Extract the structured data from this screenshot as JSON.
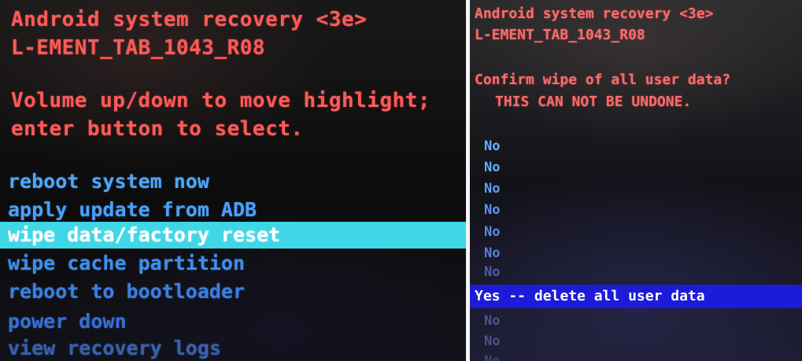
{
  "left_screen": {
    "title": "Android system recovery <3e>",
    "build": "L-EMENT_TAB_1043_R08",
    "instructions": [
      "Volume up/down to move highlight;",
      "enter button to select."
    ],
    "menu": [
      {
        "label": "reboot system now",
        "color": "#4fa6ff"
      },
      {
        "label": "apply update from ADB",
        "color": "#4aa0ff"
      },
      {
        "label": "wipe data/factory reset",
        "color": "#ffffff",
        "selected": true
      },
      {
        "label": "wipe cache partition",
        "color": "#3f8fee"
      },
      {
        "label": "reboot to bootloader",
        "color": "#3a7fe4"
      },
      {
        "label": "power down",
        "color": "#366fd8"
      },
      {
        "label": "view recovery logs",
        "color": "#3a5fb0"
      }
    ],
    "colors": {
      "header_text": "#ff5a58",
      "highlight": "#3fd6e6"
    }
  },
  "right_screen": {
    "title": "Android system recovery <3e>",
    "build": "L-EMENT_TAB_1043_R08",
    "confirm_text": "Confirm wipe of all user data?",
    "warning_text": "THIS CAN NOT BE UNDONE.",
    "options": [
      {
        "label": "No",
        "color": "#6ab0ff"
      },
      {
        "label": "No",
        "color": "#65a8ff"
      },
      {
        "label": "No",
        "color": "#5f9ff8"
      },
      {
        "label": "No",
        "color": "#5a95f0"
      },
      {
        "label": "No",
        "color": "#5a8ae0"
      },
      {
        "label": "No",
        "color": "#5a7ed0"
      },
      {
        "label": "No",
        "color": "#4a5fa8"
      },
      {
        "label": "Yes -- delete all user data",
        "color": "#ffffff",
        "selected": true
      },
      {
        "label": "No",
        "color": "#4a5590"
      },
      {
        "label": "No",
        "color": "#4a5288"
      },
      {
        "label": "No",
        "color": "#3e4470"
      }
    ],
    "colors": {
      "header_text": "#ff6a6a",
      "highlight": "#1c1cd8"
    }
  }
}
